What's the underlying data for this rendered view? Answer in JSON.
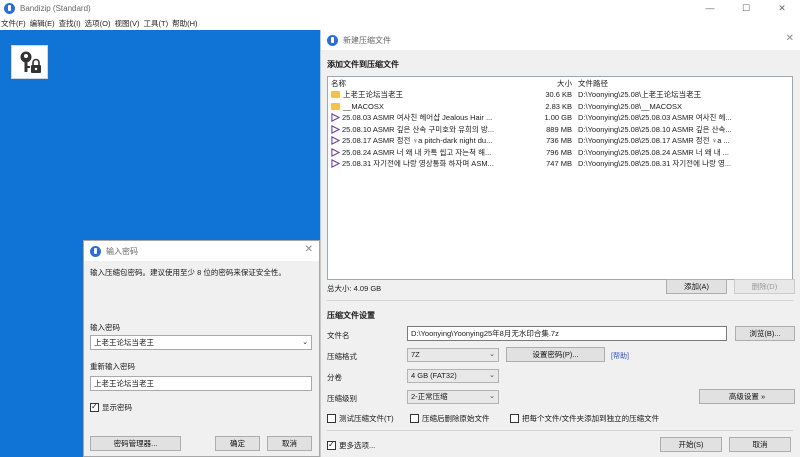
{
  "window": {
    "title": "Bandizip (Standard)",
    "controls": [
      "—",
      "☐",
      "✕"
    ]
  },
  "menu": [
    "文件(F)",
    "编辑(E)",
    "查找(I)",
    "选项(O)",
    "视图(V)",
    "工具(T)",
    "帮助(H)"
  ],
  "archive_dialog": {
    "title": "新建压缩文件",
    "add_section": "添加文件到压缩文件",
    "columns": {
      "name": "名称",
      "size": "大小",
      "path": "文件路径"
    },
    "files": [
      {
        "type": "folder",
        "name": "上老王论坛当老王",
        "size": "30.6 KB",
        "path": "D:\\Yoonying\\25.08\\上老王论坛当老王"
      },
      {
        "type": "folder",
        "name": "__MACOSX",
        "size": "2.83 KB",
        "path": "D:\\Yoonying\\25.08\\__MACOSX"
      },
      {
        "type": "video",
        "name": "25.08.03 ASMR 여사친 헤어샵  Jealous Hair ...",
        "size": "1.00 GB",
        "path": "D:\\Yoonying\\25.08\\25.08.03 ASMR 여사친 헤..."
      },
      {
        "type": "video",
        "name": "25.08.10 ASMR 깊은 산속 구미호와 유희의 방...",
        "size": "889 MB",
        "path": "D:\\Yoonying\\25.08\\25.08.10 ASMR 깊은 산속..."
      },
      {
        "type": "video",
        "name": "25.08.17 ASMR 정전 ♀a pitch-dark night du...",
        "size": "736 MB",
        "path": "D:\\Yoonying\\25.08\\25.08.17 ASMR 정전 ♀a ..."
      },
      {
        "type": "video",
        "name": "25.08.24 ASMR 너 왜 내 카톡 씹고 자는척 해...",
        "size": "796 MB",
        "path": "D:\\Yoonying\\25.08\\25.08.24 ASMR 너 왜 내 ..."
      },
      {
        "type": "video",
        "name": "25.08.31 자기전에 나랑 영상통화 하자며 ASM...",
        "size": "747 MB",
        "path": "D:\\Yoonying\\25.08\\25.08.31 자기전에 나랑 영..."
      }
    ],
    "total_size": "总大小: 4.09 GB",
    "add_button": "添加(A)",
    "delete_button": "删除(D)",
    "settings_section": "压缩文件设置",
    "filename_label": "文件名",
    "filename_value": "D:\\Yoonying\\Yoonying25年8月无水印合集.7z",
    "browse_button": "浏览(B)...",
    "format_label": "压缩格式",
    "format_value": "7Z",
    "set_password_button": "设置密码(P)...",
    "help_link": "[帮助]",
    "split_label": "分卷",
    "split_value": "4 GB (FAT32)",
    "level_label": "压缩级别",
    "level_value": "2-正常压缩",
    "advanced_button": "高级设置 »",
    "check_test": "测试压缩文件(T)",
    "check_delete_after": "压缩后删除原始文件",
    "check_separate": "把每个文件/文件夹添加到独立的压缩文件",
    "more_options": "更多选项...",
    "start_button": "开始(S)",
    "cancel_button": "取消"
  },
  "password_dialog": {
    "title": "输入密码",
    "instruction": "输入压缩包密码。建议使用至少 8 位的密码来保证安全性。",
    "enter_label": "输入密码",
    "enter_value": "上老王论坛当老王",
    "reenter_label": "重新输入密码",
    "reenter_value": "上老王论坛当老王",
    "show_password": "显示密码",
    "manager_button": "密码管理器...",
    "ok_button": "确定",
    "cancel_button": "取消"
  },
  "colors": {
    "desktop": "#0f74d6",
    "accent": "#2a6fd6",
    "folder": "#f2c14e"
  }
}
